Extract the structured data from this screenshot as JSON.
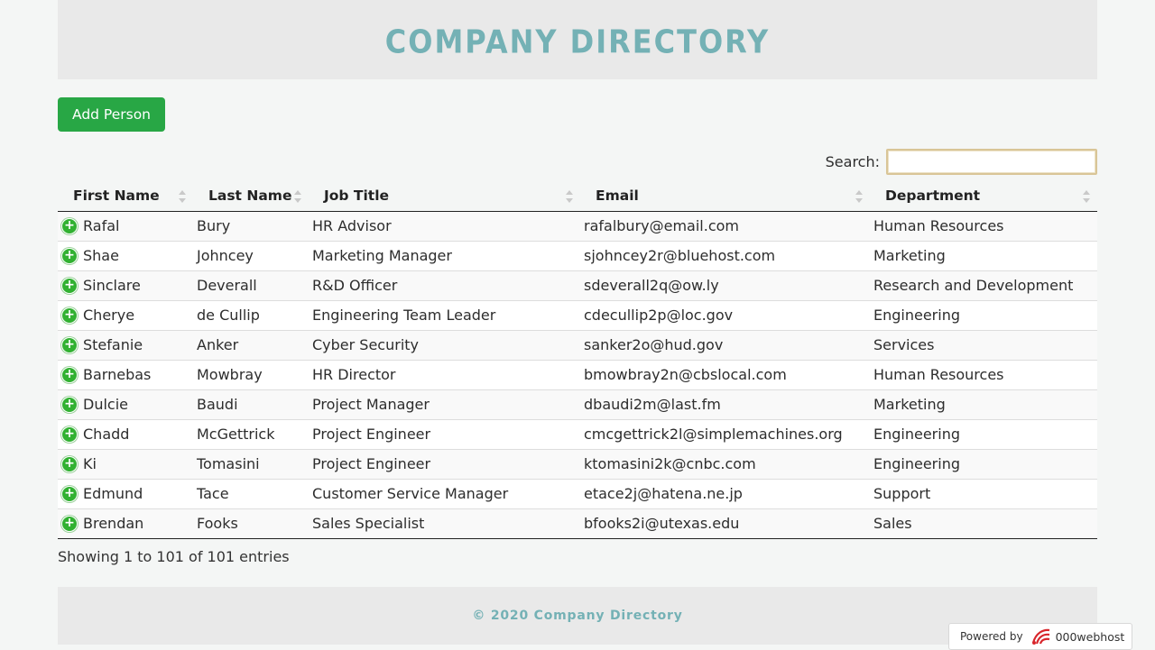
{
  "header": {
    "title": "COMPANY DIRECTORY"
  },
  "toolbar": {
    "add_label": "Add Person"
  },
  "search": {
    "label": "Search:",
    "value": "",
    "placeholder": ""
  },
  "table": {
    "columns": [
      "First Name",
      "Last Name",
      "Job Title",
      "Email",
      "Department"
    ],
    "rows": [
      [
        "Rafal",
        "Bury",
        "HR Advisor",
        "rafalbury@email.com",
        "Human Resources"
      ],
      [
        "Shae",
        "Johncey",
        "Marketing Manager",
        "sjohncey2r@bluehost.com",
        "Marketing"
      ],
      [
        "Sinclare",
        "Deverall",
        "R&D Officer",
        "sdeverall2q@ow.ly",
        "Research and Development"
      ],
      [
        "Cherye",
        "de Cullip",
        "Engineering Team Leader",
        "cdecullip2p@loc.gov",
        "Engineering"
      ],
      [
        "Stefanie",
        "Anker",
        "Cyber Security",
        "sanker2o@hud.gov",
        "Services"
      ],
      [
        "Barnebas",
        "Mowbray",
        "HR Director",
        "bmowbray2n@cbslocal.com",
        "Human Resources"
      ],
      [
        "Dulcie",
        "Baudi",
        "Project Manager",
        "dbaudi2m@last.fm",
        "Marketing"
      ],
      [
        "Chadd",
        "McGettrick",
        "Project Engineer",
        "cmcgettrick2l@simplemachines.org",
        "Engineering"
      ],
      [
        "Ki",
        "Tomasini",
        "Project Engineer",
        "ktomasini2k@cnbc.com",
        "Engineering"
      ],
      [
        "Edmund",
        "Tace",
        "Customer Service Manager",
        "etace2j@hatena.ne.jp",
        "Support"
      ],
      [
        "Brendan",
        "Fooks",
        "Sales Specialist",
        "bfooks2i@utexas.edu",
        "Sales"
      ]
    ],
    "info": "Showing 1 to 101 of 101 entries"
  },
  "footer": {
    "text": "© 2020 Company Directory"
  },
  "badge": {
    "powered_label": "Powered by",
    "brand": "000webhost"
  },
  "icons": {
    "expand": "plus-circle-icon",
    "sort": "sort-arrows-icon",
    "brand": "000webhost-logo-icon"
  },
  "colors": {
    "accent": "#74b1b5",
    "button": "#28a745",
    "expand": "#31b131"
  }
}
